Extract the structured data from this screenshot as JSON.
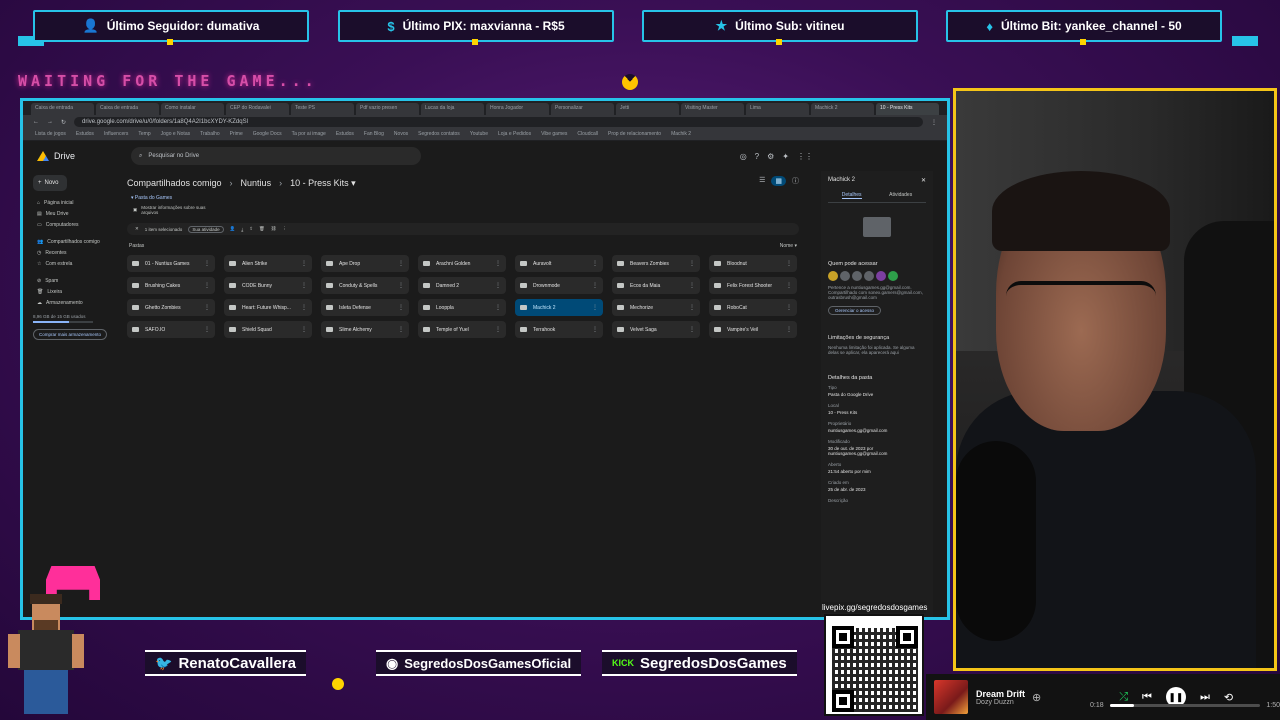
{
  "overlay": {
    "alerts": [
      {
        "icon": "👤",
        "text": "Último Seguidor: dumativa"
      },
      {
        "icon": "$",
        "text": "Último PIX: maxvianna - R$5"
      },
      {
        "icon": "★",
        "text": "Último Sub: vitineu"
      },
      {
        "icon": "♦",
        "text": "Último Bit: yankee_channel - 50"
      }
    ],
    "waiting": "WAITING FOR THE GAME...",
    "social": {
      "twitter": "RenatoCavallera",
      "instagram": "SegredosDosGamesOficial",
      "kick_icon": "KICK",
      "kick": "SegredosDosGames"
    },
    "qr_label": "livepix.gg/segredosdosgames",
    "accent": "#27c3e8",
    "cam_border": "#f5c518"
  },
  "browser": {
    "tabs": [
      "Caixa de entrada",
      "Caixa de entrada",
      "Como instalar",
      "CEP do Rodavalei",
      "Teste PS",
      "Pdf vazio presen",
      "Lucas da loja",
      "Honra Jogador",
      "Personalizar",
      "Jetti",
      "Visiting Master",
      "Lima",
      "Machick 2",
      "10 - Press Kits"
    ],
    "url": "drive.google.com/drive/u/0/folders/1a8Q4A2I1bcXYDY-KZdqSl",
    "bookmarks": [
      "Lista de jogos",
      "Estudos",
      "Influencers",
      "Temp",
      "Jogo e Notas",
      "Trabalho",
      "Prime",
      "Google Docs",
      "Ta por ai image",
      "Estudos",
      "Fan Blog",
      "Novos",
      "Segredos contatos",
      "Youtube",
      "Loja e Pedidos",
      "Vibe games",
      "Cloudcall",
      "Prop de relacionamento",
      "Machik 2"
    ]
  },
  "drive": {
    "logo": "Drive",
    "search_placeholder": "Pesquisar no Drive",
    "new_label": "Novo",
    "sidebar": [
      "Página inicial",
      "Meu Drive",
      "Computadores",
      "Compartilhados comigo",
      "Recentes",
      "Com estrela",
      "Spam",
      "Lixeira",
      "Armazenamento"
    ],
    "quota": "8,96 GB de 15 GB usados",
    "buy": "Comprar mais armazenamento",
    "breadcrumb": [
      "Compartilhados comigo",
      "Nuntius",
      "10 - Press Kits ▾"
    ],
    "folder_info": "Pasta do Games",
    "tip": "Mostrar informações sobre suas arquivos",
    "filters": [
      "1 item selecionado",
      "Sua atividade"
    ],
    "section": "Pastas",
    "sort": "Nome ▾",
    "folders": [
      "01 - Nuntius Games",
      "Alien Strike",
      "Ape Drop",
      "Arachni Golden",
      "Auravolt",
      "Beavers Zombies",
      "Bloodnut",
      "Brushing Cakes",
      "CODE Bunny",
      "Conduty & Spells",
      "Damned 2",
      "Drownmode",
      "Ecos da Maia",
      "Felix Forest Shooter",
      "Ghetto Zombies",
      "Heart: Future Whisp...",
      "Isleta Defense",
      "Looppla",
      "Machick 2",
      "Mechorize",
      "RoboCat",
      "SAFO.IO",
      "Shield Squad",
      "Slime Alchemy",
      "Temple of Yuel",
      "Terrahook",
      "Velvet Saga",
      "Vampire's Veil"
    ],
    "selected_index": 18,
    "details": {
      "title": "Machick 2",
      "tabs": [
        "Detalhes",
        "Atividades"
      ],
      "access_title": "Quem pode acessar",
      "access_text": "Pertence a nuntiusgames.gg@gmail.com. Compartilhado com sonex.gamers@gmail.com, outrasbrush@gmail.com",
      "manage": "Gerenciar o acesso",
      "security_title": "Limitações de segurança",
      "security_text": "Nenhuma limitação foi aplicada. Se alguma delas se aplicar, ela aparecerá aqui",
      "folder_title": "Detalhes da pasta",
      "rows": [
        {
          "label": "Tipo",
          "value": "Pasta do Google Drive"
        },
        {
          "label": "Local",
          "value": "10 - Press Kits"
        },
        {
          "label": "Proprietário",
          "value": "nuntiusgames.gg@gmail.com"
        },
        {
          "label": "Modificado",
          "value": "30 de out. de 2023 por nuntiusgames.gg@gmail.com"
        },
        {
          "label": "Aberto",
          "value": "21:54 aberto por mim"
        },
        {
          "label": "Criado em",
          "value": "25 de abr. de 2023"
        },
        {
          "label": "Descrição",
          "value": ""
        }
      ]
    }
  },
  "player": {
    "title": "Dream Drift",
    "artist": "Dozy Duzzn",
    "elapsed": "0:18",
    "duration": "1:50",
    "progress": 0.16
  }
}
